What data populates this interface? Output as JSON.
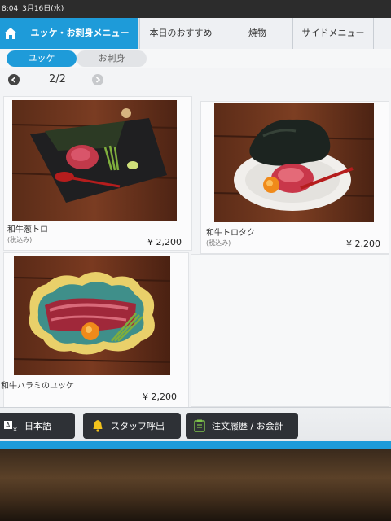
{
  "status": {
    "time": "8:04",
    "date": "3月16日(水)"
  },
  "tabs": [
    {
      "label": "ユッケ・お刺身メニュー",
      "active": true
    },
    {
      "label": "本日のおすすめ",
      "active": false
    },
    {
      "label": "焼物",
      "active": false
    },
    {
      "label": "サイドメニュー",
      "active": false
    }
  ],
  "subtabs": [
    {
      "label": "ユッケ",
      "active": true
    },
    {
      "label": "お刺身",
      "active": false
    }
  ],
  "pager": {
    "label": "2/2"
  },
  "items": [
    {
      "name": "和牛葱トロ",
      "tax_note": "(税込み)",
      "price": "¥ 2,200"
    },
    {
      "name": "和牛トロタク",
      "tax_note": "(税込み)",
      "price": "¥ 2,200"
    },
    {
      "name": "和牛ハラミのユッケ",
      "tax_note": "",
      "price": "¥ 2,200"
    }
  ],
  "bottom": {
    "language": "日本語",
    "call_staff": "スタッフ呼出",
    "history": "注文履歴 / お会計"
  },
  "colors": {
    "accent": "#1e9bd9",
    "button_dark": "#2e3136"
  }
}
